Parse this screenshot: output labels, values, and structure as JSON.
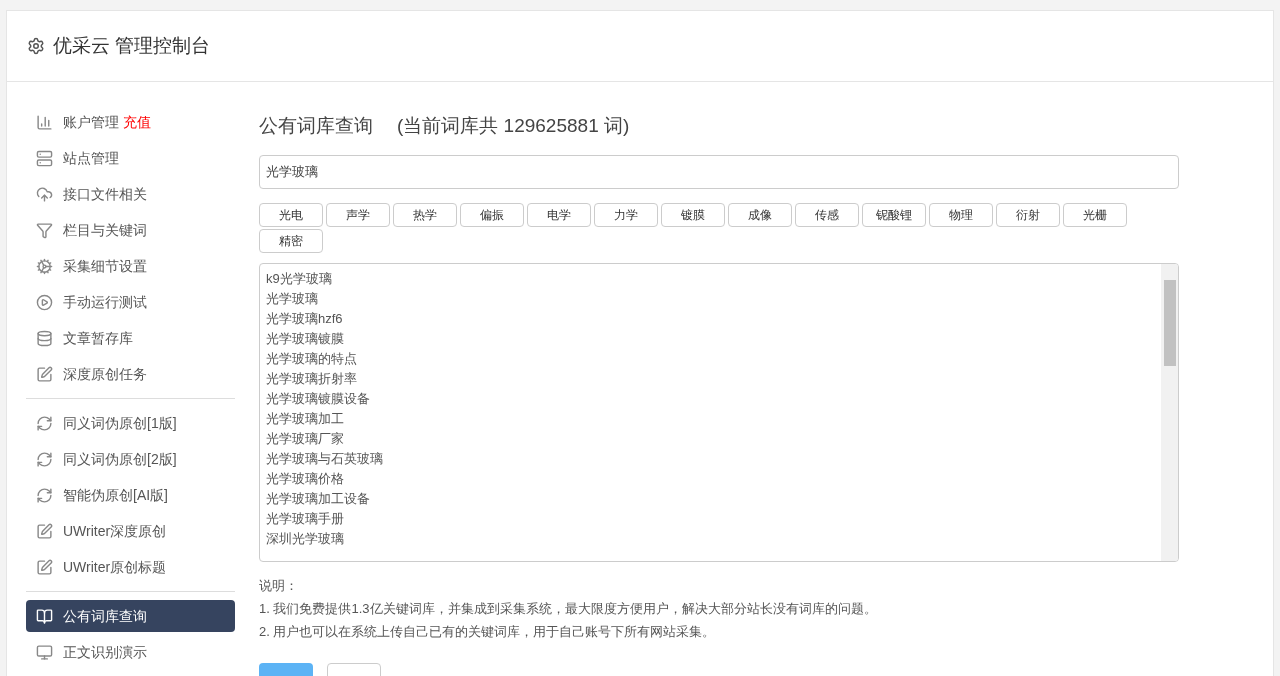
{
  "header": {
    "title": "优采云 管理控制台"
  },
  "sidebar": {
    "sections": [
      {
        "items": [
          {
            "label": "账户管理",
            "badge": "充值",
            "selected": false
          },
          {
            "label": "站点管理",
            "selected": false
          },
          {
            "label": "接口文件相关",
            "selected": false
          },
          {
            "label": "栏目与关键词",
            "selected": false
          },
          {
            "label": "采集细节设置",
            "selected": false
          },
          {
            "label": "手动运行测试",
            "selected": false
          },
          {
            "label": "文章暂存库",
            "selected": false
          },
          {
            "label": "深度原创任务",
            "selected": false
          }
        ]
      },
      {
        "items": [
          {
            "label": "同义词伪原创[1版]",
            "selected": false
          },
          {
            "label": "同义词伪原创[2版]",
            "selected": false
          },
          {
            "label": "智能伪原创[AI版]",
            "selected": false
          },
          {
            "label": "UWriter深度原创",
            "selected": false
          },
          {
            "label": "UWriter原创标题",
            "selected": false
          }
        ]
      },
      {
        "items": [
          {
            "label": "公有词库查询",
            "selected": true
          },
          {
            "label": "正文识别演示",
            "selected": false
          }
        ]
      }
    ]
  },
  "main": {
    "title": "公有词库查询",
    "count": "(当前词库共 129625881 词)",
    "search": {
      "value": "光学玻璃"
    },
    "tags": [
      "光电",
      "声学",
      "热学",
      "偏振",
      "电学",
      "力学",
      "镀膜",
      "成像",
      "传感",
      "铌酸锂",
      "物理",
      "衍射",
      "光栅",
      "精密"
    ],
    "results": [
      "k9光学玻璃",
      "光学玻璃",
      "光学玻璃hzf6",
      "光学玻璃镀膜",
      "光学玻璃的特点",
      "光学玻璃折射率",
      "光学玻璃镀膜设备",
      "光学玻璃加工",
      "光学玻璃厂家",
      "光学玻璃与石英玻璃",
      "光学玻璃价格",
      "光学玻璃加工设备",
      "光学玻璃手册",
      "深圳光学玻璃"
    ],
    "notes_title": "说明：",
    "notes": [
      "1. 我们免费提供1.3亿关键词库，并集成到采集系统，最大限度方便用户，解决大部分站长没有词库的问题。",
      "2. 用户也可以在系统上传自己已有的关键词库，用于自己账号下所有网站采集。"
    ],
    "buttons": [
      {
        "kind": "primary"
      },
      {
        "kind": "default"
      }
    ]
  }
}
